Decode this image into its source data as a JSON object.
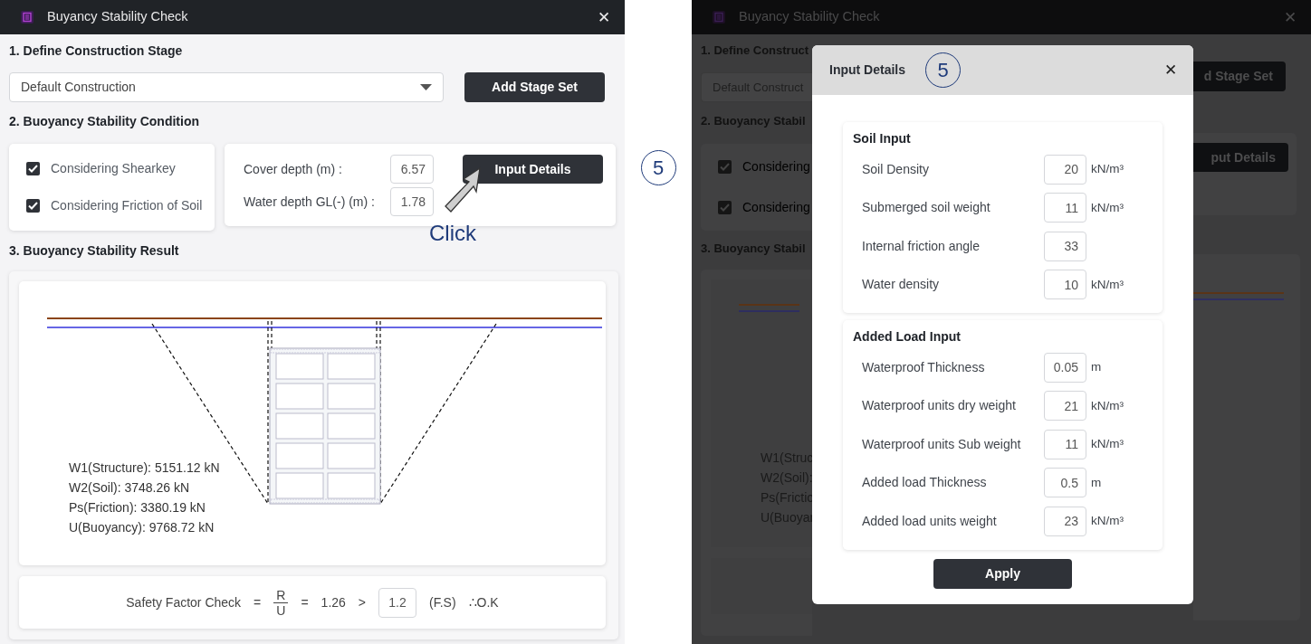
{
  "main_window": {
    "title": "Buyancy Stability Check",
    "close": "✕",
    "section_1": {
      "heading": "1. Define Construction Stage",
      "stage_select": {
        "value": "Default Construction"
      },
      "add_button": "Add Stage Set"
    },
    "section_2": {
      "heading": "2. Buoyancy Stability Condition",
      "options": [
        {
          "label": "Considering Shearkey",
          "checked": true
        },
        {
          "label": "Considering Friction of Soil",
          "checked": true
        }
      ],
      "fields": [
        {
          "label": "Cover depth (m) :",
          "value": "6.57"
        },
        {
          "label": "Water depth GL(-) (m) :",
          "value": "1.78"
        }
      ],
      "details_button": "Input Details"
    },
    "section_3": {
      "heading": "3. Buoyancy Stability Result",
      "forces": [
        "W1(Structure): 5151.12 kN",
        "W2(Soil): 3748.26 kN",
        "Ps(Friction): 3380.19 kN",
        "U(Buoyancy): 9768.72 kN"
      ],
      "safety_check": {
        "label": "Safety Factor Check",
        "eq1": "=",
        "numerator": "R",
        "denominator": "U",
        "eq2": "=",
        "ratio": "1.26",
        "comparator": ">",
        "required": "1.2",
        "required_label": "(F.S)",
        "verdict": "∴O.K"
      }
    }
  },
  "annotation": {
    "step": "5",
    "click_label": "Click"
  },
  "dimmed_window": {
    "title": "Buyancy Stability Check",
    "close": "✕",
    "left_texts": {
      "heading_1": "1. Define Construct",
      "select_value": "Default Construct",
      "heading_2": "2. Buoyancy Stabil",
      "options": [
        {
          "label": "Considering",
          "checked": true
        },
        {
          "label": "Considering",
          "checked": true
        }
      ],
      "heading_3": "3. Buoyancy Stabil",
      "forces": [
        "W1(Struc",
        "W2(Soil):",
        "Ps(Frictio",
        "U(Buoyar"
      ]
    },
    "right_texts": {
      "add_button": "d Stage Set",
      "details_button": "put Details"
    }
  },
  "modal": {
    "title": "Input Details",
    "step": "5",
    "close": "✕",
    "groups": [
      {
        "title": "Soil Input",
        "fields": [
          {
            "label": "Soil Density",
            "value": "20",
            "unit": "kN/m³"
          },
          {
            "label": "Submerged soil weight",
            "value": "11",
            "unit": "kN/m³"
          },
          {
            "label": "Internal friction angle",
            "value": "33"
          },
          {
            "label": "Water density",
            "value": "10",
            "unit": "kN/m³"
          }
        ]
      },
      {
        "title": "Added Load Input",
        "fields": [
          {
            "label": "Waterproof Thickness",
            "value": "0.05",
            "unit": "m"
          },
          {
            "label": "Waterproof units dry weight",
            "value": "21",
            "unit": "kN/m³"
          },
          {
            "label": "Waterproof units Sub weight",
            "value": "11",
            "unit": "kN/m³"
          },
          {
            "label": "Added load Thickness",
            "value": "0.5",
            "unit": "m"
          },
          {
            "label": "Added load units weight",
            "value": "23",
            "unit": "kN/m³"
          }
        ]
      }
    ],
    "apply_button": "Apply"
  }
}
